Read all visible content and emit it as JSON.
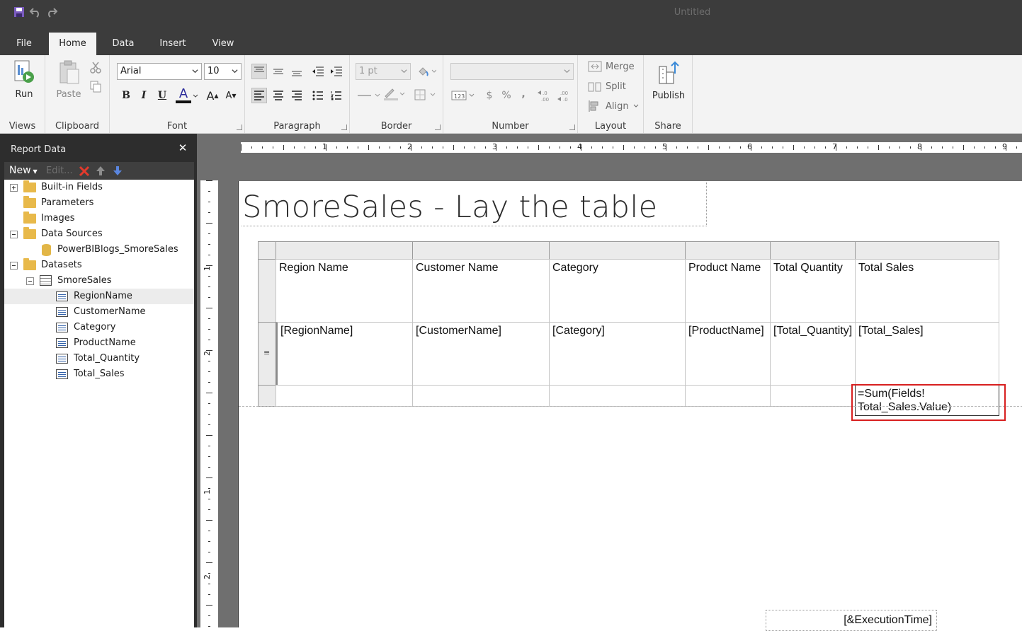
{
  "window": {
    "title": "Untitled"
  },
  "quick_access": [
    "save-icon",
    "undo-icon",
    "redo-icon"
  ],
  "tabs": [
    {
      "label": "File",
      "active": false
    },
    {
      "label": "Home",
      "active": true
    },
    {
      "label": "Data",
      "active": false
    },
    {
      "label": "Insert",
      "active": false
    },
    {
      "label": "View",
      "active": false
    }
  ],
  "ribbon": {
    "groups": {
      "views": "Views",
      "clipboard": "Clipboard",
      "font": "Font",
      "paragraph": "Paragraph",
      "border": "Border",
      "number": "Number",
      "layout": "Layout",
      "share": "Share"
    },
    "run_label": "Run",
    "paste_label": "Paste",
    "font_name": "Arial",
    "font_size": "10",
    "border_width": "1 pt",
    "merge_label": "Merge",
    "split_label": "Split",
    "align_label": "Align",
    "publish_label": "Publish",
    "bold": "B",
    "italic": "I",
    "underline": "U",
    "font_color": "A",
    "currency": "$",
    "percent": "%",
    "comma": ","
  },
  "report_data": {
    "title": "Report Data",
    "new_label": "New",
    "edit_label": "Edit...",
    "tree": {
      "built_in_fields": "Built-in Fields",
      "parameters": "Parameters",
      "images": "Images",
      "data_sources": "Data Sources",
      "data_source_item": "PowerBIBlogs_SmoreSales",
      "datasets": "Datasets",
      "dataset": "SmoreSales",
      "fields": [
        "RegionName",
        "CustomerName",
        "Category",
        "ProductName",
        "Total_Quantity",
        "Total_Sales"
      ]
    }
  },
  "rulers": {
    "horizontal": [
      "1",
      "2",
      "3",
      "4",
      "5",
      "6",
      "7",
      "8",
      "9"
    ],
    "vertical": [
      "1",
      "2",
      "1",
      "2"
    ]
  },
  "report": {
    "title": "SmoreSales - Lay the table",
    "headers": [
      "Region Name",
      "Customer Name",
      "Category",
      "Product Name",
      "Total Quantity",
      "Total Sales"
    ],
    "details": [
      "[RegionName]",
      "[CustomerName]",
      "[Category]",
      "[ProductName]",
      "[Total_Quantity]",
      "[Total_Sales]"
    ],
    "total_expression_line1": "=Sum(Fields!",
    "total_expression_line2": "Total_Sales.Value)",
    "footer": "[&ExecutionTime]",
    "highlight_color": "#d81f1f"
  }
}
